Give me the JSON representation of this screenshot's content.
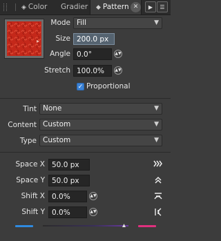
{
  "tabs": {
    "color_label": "Color",
    "gradient_label": "Gradier",
    "pattern_label": "Pattern",
    "close_glyph": "✕",
    "play_glyph": "▶",
    "menu_glyph": "☰"
  },
  "pattern": {
    "mode_label": "Mode",
    "mode_value": "Fill",
    "size_label": "Size",
    "size_value": "200.0 px",
    "angle_label": "Angle",
    "angle_value": "0.0°",
    "stretch_label": "Stretch",
    "stretch_value": "100.0%",
    "proportional_label": "Proportional",
    "proportional_checked": true
  },
  "options": {
    "tint_label": "Tint",
    "tint_value": "None",
    "content_label": "Content",
    "content_value": "Custom",
    "type_label": "Type",
    "type_value": "Custom"
  },
  "spacing": {
    "space_x_label": "Space X",
    "space_x_value": "50.0 px",
    "space_y_label": "Space Y",
    "space_y_value": "50.0 px",
    "shift_x_label": "Shift X",
    "shift_x_value": "0.0%",
    "shift_y_label": "Shift Y",
    "shift_y_value": "0.0%"
  },
  "icons": {
    "space_x_icon": "fast-forward-chevrons-icon",
    "space_y_icon": "double-chevron-up-icon",
    "shift_x_icon": "shift-x-icon",
    "shift_y_icon": "shift-y-icon"
  },
  "colors": {
    "panel_bg": "#3c3c3c",
    "accent_blue": "#2f8ae0",
    "accent_pink": "#e0307e",
    "pattern_red": "#c4281a"
  }
}
